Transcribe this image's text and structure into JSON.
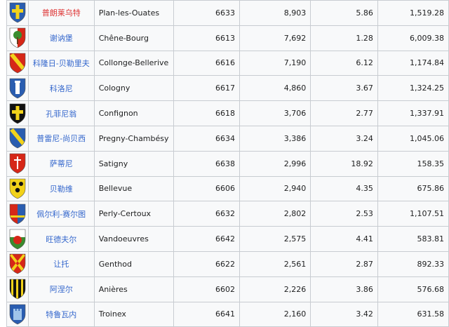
{
  "table": {
    "rows": [
      {
        "zh": "普朗莱乌特",
        "zh_link": "redlink",
        "fr": "Plan-les-Ouates",
        "code": "6633",
        "pop": "8,903",
        "area": "5.86",
        "density": "1,519.28",
        "crest": {
          "field": "#2a5db0",
          "pattern": "cross",
          "accent": "#f2d21a"
        }
      },
      {
        "zh": "谢讷堡",
        "fr": "Chêne-Bourg",
        "code": "6613",
        "pop": "7,692",
        "area": "1.28",
        "density": "6,009.38",
        "crest": {
          "field": "#d62718",
          "pattern": "tree",
          "accent": "#3a8c2e"
        }
      },
      {
        "zh": "科隆日-贝勒里夫",
        "fr": "Collonge-Bellerive",
        "code": "6616",
        "pop": "7,190",
        "area": "6.12",
        "density": "1,174.84",
        "crest": {
          "field": "#d62718",
          "pattern": "bend",
          "accent": "#f2d21a"
        }
      },
      {
        "zh": "科洛尼",
        "fr": "Cologny",
        "code": "6617",
        "pop": "4,860",
        "area": "3.67",
        "density": "1,324.25",
        "crest": {
          "field": "#2a5db0",
          "pattern": "tower",
          "accent": "#ffffff"
        }
      },
      {
        "zh": "孔菲尼翁",
        "fr": "Confignon",
        "code": "6618",
        "pop": "3,706",
        "area": "2.77",
        "density": "1,337.91",
        "crest": {
          "field": "#111111",
          "pattern": "cross",
          "accent": "#f2d21a"
        }
      },
      {
        "zh": "普雷尼-尚贝西",
        "fr": "Pregny-Chambésy",
        "code": "6634",
        "pop": "3,386",
        "area": "3.24",
        "density": "1,045.06",
        "crest": {
          "field": "#2a5db0",
          "pattern": "bend",
          "accent": "#f2d21a"
        }
      },
      {
        "zh": "萨蒂尼",
        "fr": "Satigny",
        "code": "6638",
        "pop": "2,996",
        "area": "18.92",
        "density": "158.35",
        "crest": {
          "field": "#d62718",
          "pattern": "sword",
          "accent": "#ffffff"
        }
      },
      {
        "zh": "贝勒维",
        "fr": "Bellevue",
        "code": "6606",
        "pop": "2,940",
        "area": "4.35",
        "density": "675.86",
        "crest": {
          "field": "#f2d21a",
          "pattern": "eagles",
          "accent": "#111111"
        }
      },
      {
        "zh": "佩尔利-赛尔图",
        "fr": "Perly-Certoux",
        "code": "6632",
        "pop": "2,802",
        "area": "2.53",
        "density": "1,107.51",
        "crest": {
          "field": "#d62718",
          "pattern": "split",
          "accent": "#2a5db0"
        }
      },
      {
        "zh": "旺德夫尔",
        "fr": "Vandoeuvres",
        "code": "6642",
        "pop": "2,575",
        "area": "4.41",
        "density": "583.81",
        "crest": {
          "field": "#3a8c2e",
          "pattern": "sun",
          "accent": "#d62718"
        }
      },
      {
        "zh": "让托",
        "fr": "Genthod",
        "code": "6622",
        "pop": "2,561",
        "area": "2.87",
        "density": "892.33",
        "crest": {
          "field": "#d62718",
          "pattern": "saltire",
          "accent": "#f2d21a"
        }
      },
      {
        "zh": "阿涅尔",
        "fr": "Anières",
        "code": "6602",
        "pop": "2,226",
        "area": "3.86",
        "density": "576.68",
        "crest": {
          "field": "#111111",
          "pattern": "stripes",
          "accent": "#f2d21a"
        }
      },
      {
        "zh": "特鲁瓦内",
        "fr": "Troinex",
        "code": "6641",
        "pop": "2,160",
        "area": "3.42",
        "density": "631.58",
        "crest": {
          "field": "#2a5db0",
          "pattern": "castle",
          "accent": "#9fc4ea"
        }
      }
    ]
  }
}
